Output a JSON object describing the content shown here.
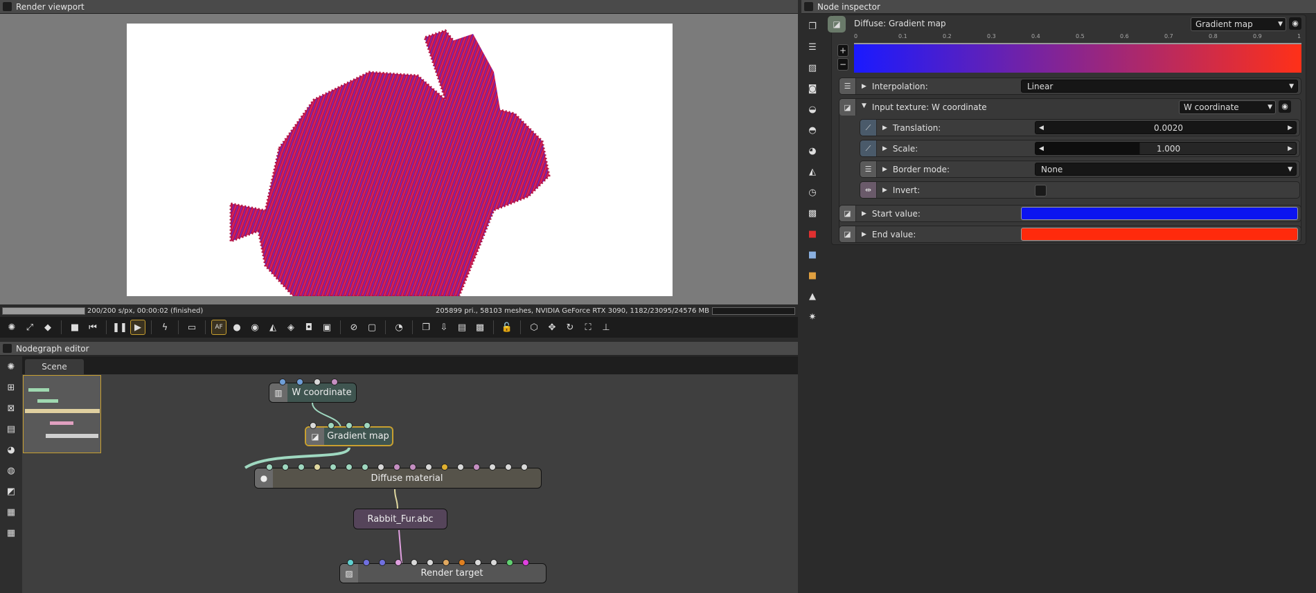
{
  "viewport": {
    "title": "Render viewport",
    "status_left": "200/200 s/px, 00:00:02 (finished)",
    "status_right": "205899 pri., 58103 meshes, NVIDIA GeForce RTX 3090, 1182/23095/24576 MB",
    "progress": 1.0
  },
  "toolbar": {
    "icons": [
      "render-settings-icon",
      "fit-icon",
      "color-cube-icon",
      "|",
      "stop-icon",
      "rewind-icon",
      "|",
      "pause-icon",
      "play-icon",
      "|",
      "lightning-icon",
      "|",
      "monitor-icon",
      "|",
      "autofocus-icon",
      "color-wheel-icon",
      "sphere-icon",
      "pick-material-icon",
      "pick-object-icon",
      "pick-focus-icon",
      "pick-camera-icon",
      "|",
      "zoom-region-icon",
      "region-icon",
      "|",
      "dial-icon",
      "|",
      "copy-icon",
      "export-icon",
      "save-icon",
      "checker-icon",
      "|",
      "lock-icon",
      "|",
      "cube-icon",
      "move-icon",
      "rotate-icon",
      "fullscreen-icon",
      "axes-icon"
    ],
    "glyphs": {
      "render-settings-icon": "✺",
      "fit-icon": "⤢",
      "color-cube-icon": "◆",
      "stop-icon": "■",
      "rewind-icon": "⏮",
      "pause-icon": "❚❚",
      "play-icon": "▶",
      "lightning-icon": "ϟ",
      "monitor-icon": "▭",
      "autofocus-icon": "AF",
      "color-wheel-icon": "●",
      "sphere-icon": "◉",
      "pick-material-icon": "◭",
      "pick-object-icon": "◈",
      "pick-focus-icon": "◘",
      "pick-camera-icon": "▣",
      "zoom-region-icon": "⊘",
      "region-icon": "▢",
      "dial-icon": "◔",
      "copy-icon": "❐",
      "export-icon": "⇩",
      "save-icon": "▤",
      "checker-icon": "▩",
      "lock-icon": "🔓",
      "cube-icon": "⬡",
      "move-icon": "✥",
      "rotate-icon": "↻",
      "fullscreen-icon": "⛶",
      "axes-icon": "⊥"
    },
    "active": [
      "play-icon",
      "autofocus-icon"
    ]
  },
  "nodegraph": {
    "title": "Nodegraph editor",
    "tab": "Scene",
    "side_icons": [
      "render-icon",
      "graph-layout-icon",
      "grid-icon",
      "inspector-icon",
      "material-icon",
      "sphere-icon",
      "geometry-icon",
      "table-icon",
      "spreadsheet-icon"
    ],
    "nodes": {
      "w_coordinate": "W coordinate",
      "gradient_map": "Gradient map",
      "diffuse_material": "Diffuse material",
      "rabbit_fur": "Rabbit_Fur.abc",
      "render_target": "Render target"
    },
    "pin_colors": {
      "w_coordinate": [
        "#6f9fd8",
        "#6f9fd8",
        "#d9d9d9",
        "#c58fc2"
      ],
      "gradient_map": [
        "#d9d9d9",
        "#9fd8c0",
        "#9fd8c0",
        "#9fd8c0"
      ],
      "diffuse_material": [
        "#9fd8c0",
        "#9fd8c0",
        "#9fd8c0",
        "#e0d8a0",
        "#9fd8c0",
        "#9fd8c0",
        "#9fd8c0",
        "#d9d9d9",
        "#c58fc2",
        "#c58fc2",
        "#d9d9d9",
        "#e0b030",
        "#d9d9d9",
        "#c58fc2",
        "#d9d9d9",
        "#d9d9d9",
        "#d9d9d9"
      ],
      "render_target": [
        "#60d0d0",
        "#7070e0",
        "#7070e0",
        "#e0a0e0",
        "#d9d9d9",
        "#d9d9d9",
        "#e0a860",
        "#e08020",
        "#d9d9d9",
        "#d9d9d9",
        "#60d070",
        "#e040e0"
      ]
    }
  },
  "inspector": {
    "title": "Node inspector",
    "side_icons": [
      "layers-icon",
      "stack-icon",
      "image-icon",
      "camera-icon",
      "environment-icon",
      "kernel-icon",
      "material-icon",
      "texture-icon",
      "clock-icon",
      "emission-icon",
      "red-cube-icon",
      "blue-cube-icon",
      "orange-cube-icon",
      "output-icon",
      "light-icon"
    ],
    "header": {
      "label": "Diffuse: Gradient map",
      "type": "Gradient map"
    },
    "gradient": {
      "ticks": [
        "0",
        "0.1",
        "0.2",
        "0.3",
        "0.4",
        "0.5",
        "0.6",
        "0.7",
        "0.8",
        "0.9",
        "1"
      ],
      "start_color": "#1a1aff",
      "end_color": "#ff3018",
      "add": "+",
      "remove": "−"
    },
    "interpolation": {
      "label": "Interpolation:",
      "value": "Linear"
    },
    "input_texture": {
      "label": "Input texture: W coordinate",
      "type": "W coordinate"
    },
    "translation": {
      "label": "Translation:",
      "value": "0.0020"
    },
    "scale": {
      "label": "Scale:",
      "value": "1.000",
      "fill": 0.4
    },
    "border_mode": {
      "label": "Border mode:",
      "value": "None"
    },
    "invert": {
      "label": "Invert:",
      "checked": false
    },
    "start_value": {
      "label": "Start value:",
      "color": "#0c14f0"
    },
    "end_value": {
      "label": "End value:",
      "color": "#ff2a0c"
    }
  }
}
